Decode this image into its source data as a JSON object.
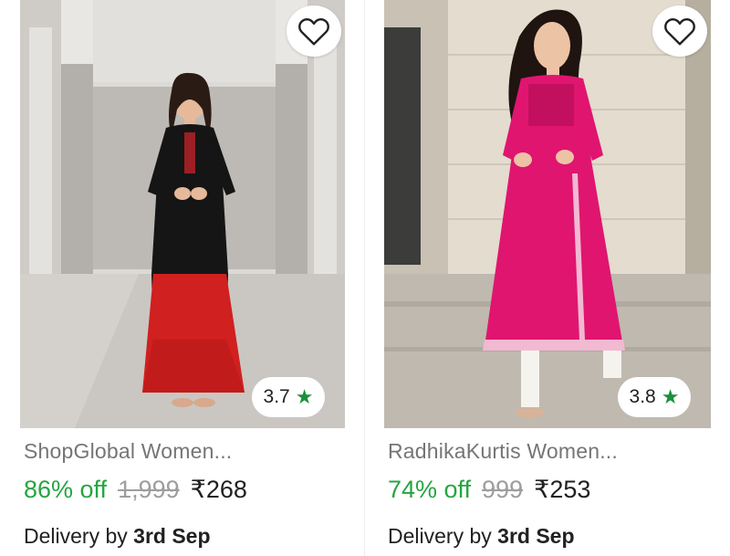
{
  "products": [
    {
      "title": "ShopGlobal Women...",
      "discount": "86% off",
      "mrp": "1,999",
      "price": "₹268",
      "rating": "3.7",
      "rating_icon": "star-icon",
      "wishlist_icon": "heart-outline-icon",
      "delivery_prefix": "Delivery by",
      "delivery_date": "3rd Sep",
      "image": "woman-in-black-and-red-kurta"
    },
    {
      "title": "RadhikaKurtis Women...",
      "discount": "74% off",
      "mrp": "999",
      "price": "₹253",
      "rating": "3.8",
      "rating_icon": "star-icon",
      "wishlist_icon": "heart-outline-icon",
      "delivery_prefix": "Delivery by",
      "delivery_date": "3rd Sep",
      "image": "woman-in-pink-kurta"
    }
  ],
  "colors": {
    "discount_green": "#26a541",
    "star_green": "#1b8f3a",
    "muted_text": "#757575",
    "strike_gray": "#9e9e9e"
  }
}
